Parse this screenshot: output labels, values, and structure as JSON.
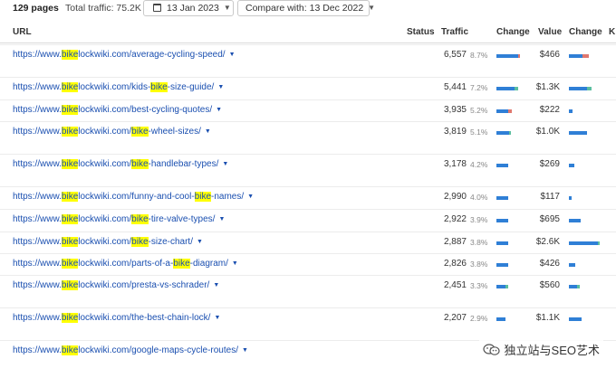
{
  "summary": {
    "pages": "129 pages",
    "total_traffic": "Total traffic: 75.2K"
  },
  "filters": {
    "date": "13 Jan 2023",
    "compare": "Compare with: 13 Dec 2022"
  },
  "columns": {
    "url": "URL",
    "status": "Status",
    "traffic": "Traffic",
    "change": "Change",
    "value": "Value",
    "change2": "Change",
    "cut": "K"
  },
  "rows": [
    {
      "prefix": "https://www.",
      "parts": [
        {
          "t": "bike",
          "hl": true
        },
        {
          "t": "lockwiki.com/average-cycling-speed/",
          "hl": false
        }
      ],
      "traffic": "6,557",
      "share": "8.7%",
      "change_parts": [
        0.75,
        0.05
      ],
      "value": "$466",
      "value_parts": [
        0.45,
        0.2
      ]
    },
    {
      "prefix": "https://www.",
      "parts": [
        {
          "t": "bike",
          "hl": true
        },
        {
          "t": "lockwiki.com/kids-",
          "hl": false
        },
        {
          "t": "bike",
          "hl": true
        },
        {
          "t": "-size-guide/",
          "hl": false
        }
      ],
      "traffic": "5,441",
      "share": "7.2%",
      "change_parts": [
        0.62,
        0.12
      ],
      "value": "$1.3K",
      "value_parts": [
        0.6,
        0.15
      ]
    },
    {
      "prefix": "https://www.",
      "parts": [
        {
          "t": "bike",
          "hl": true
        },
        {
          "t": "lockwiki.com/best-cycling-quotes/",
          "hl": false
        }
      ],
      "traffic": "3,935",
      "share": "5.2%",
      "change_parts": [
        0.42,
        0.12
      ],
      "value": "$222",
      "value_parts": [
        0.12,
        0
      ]
    },
    {
      "prefix": "https://www.",
      "parts": [
        {
          "t": "bike",
          "hl": true
        },
        {
          "t": "lockwiki.com/",
          "hl": false
        },
        {
          "t": "bike",
          "hl": true
        },
        {
          "t": "-wheel-sizes/",
          "hl": false
        }
      ],
      "traffic": "3,819",
      "share": "5.1%",
      "change_parts": [
        0.45,
        0.05
      ],
      "value": "$1.0K",
      "value_parts": [
        0.6,
        0
      ]
    },
    {
      "prefix": "https://www.",
      "parts": [
        {
          "t": "bike",
          "hl": true
        },
        {
          "t": "lockwiki.com/",
          "hl": false
        },
        {
          "t": "bike",
          "hl": true
        },
        {
          "t": "-handlebar-types/",
          "hl": false
        }
      ],
      "traffic": "3,178",
      "share": "4.2%",
      "change_parts": [
        0.42,
        0
      ],
      "value": "$269",
      "value_parts": [
        0.18,
        0
      ]
    },
    {
      "prefix": "https://www.",
      "parts": [
        {
          "t": "bike",
          "hl": true
        },
        {
          "t": "lockwiki.com/funny-and-cool-",
          "hl": false
        },
        {
          "t": "bike",
          "hl": true
        },
        {
          "t": "-names/",
          "hl": false
        }
      ],
      "traffic": "2,990",
      "share": "4.0%",
      "change_parts": [
        0.4,
        0
      ],
      "value": "$117",
      "value_parts": [
        0.08,
        0
      ]
    },
    {
      "prefix": "https://www.",
      "parts": [
        {
          "t": "bike",
          "hl": true
        },
        {
          "t": "lockwiki.com/",
          "hl": false
        },
        {
          "t": "bike",
          "hl": true
        },
        {
          "t": "-tire-valve-types/",
          "hl": false
        }
      ],
      "traffic": "2,922",
      "share": "3.9%",
      "change_parts": [
        0.42,
        0
      ],
      "value": "$695",
      "value_parts": [
        0.38,
        0
      ]
    },
    {
      "prefix": "https://www.",
      "parts": [
        {
          "t": "bike",
          "hl": true
        },
        {
          "t": "lockwiki.com/",
          "hl": false
        },
        {
          "t": "bike",
          "hl": true
        },
        {
          "t": "-size-chart/",
          "hl": false
        }
      ],
      "traffic": "2,887",
      "share": "3.8%",
      "change_parts": [
        0.42,
        0
      ],
      "value": "$2.6K",
      "value_parts": [
        0.94,
        0.06
      ]
    },
    {
      "prefix": "https://www.",
      "parts": [
        {
          "t": "bike",
          "hl": true
        },
        {
          "t": "lockwiki.com/parts-of-a-",
          "hl": false
        },
        {
          "t": "bike",
          "hl": true
        },
        {
          "t": "-diagram/",
          "hl": false
        }
      ],
      "traffic": "2,826",
      "share": "3.8%",
      "change_parts": [
        0.42,
        0
      ],
      "value": "$426",
      "value_parts": [
        0.22,
        0
      ]
    },
    {
      "prefix": "https://www.",
      "parts": [
        {
          "t": "bike",
          "hl": true
        },
        {
          "t": "lockwiki.com/presta-vs-schrader/",
          "hl": false
        }
      ],
      "traffic": "2,451",
      "share": "3.3%",
      "change_parts": [
        0.3,
        0.08
      ],
      "value": "$560",
      "value_parts": [
        0.26,
        0.08
      ]
    },
    {
      "prefix": "https://www.",
      "parts": [
        {
          "t": "bike",
          "hl": true
        },
        {
          "t": "lockwiki.com/the-best-chain-lock/",
          "hl": false
        }
      ],
      "traffic": "2,207",
      "share": "2.9%",
      "change_parts": [
        0.3,
        0
      ],
      "value": "$1.1K",
      "value_parts": [
        0.42,
        0
      ]
    },
    {
      "prefix": "https://www.",
      "parts": [
        {
          "t": "bike",
          "hl": true
        },
        {
          "t": "lockwiki.com/google-maps-cycle-routes/",
          "hl": false
        }
      ],
      "traffic": "",
      "share": "",
      "change_parts": [
        0,
        0
      ],
      "value": "",
      "value_parts": [
        0,
        0
      ]
    }
  ],
  "colors": {
    "link": "#1a4fb0",
    "highlight": "#ffff00",
    "bar_primary": "#2f7fd6",
    "bar_up": "#e0786f",
    "bar_teal": "#5cbfa0"
  },
  "watermark": {
    "text": "独立站与SEO艺术",
    "icon": "wechat-icon"
  }
}
